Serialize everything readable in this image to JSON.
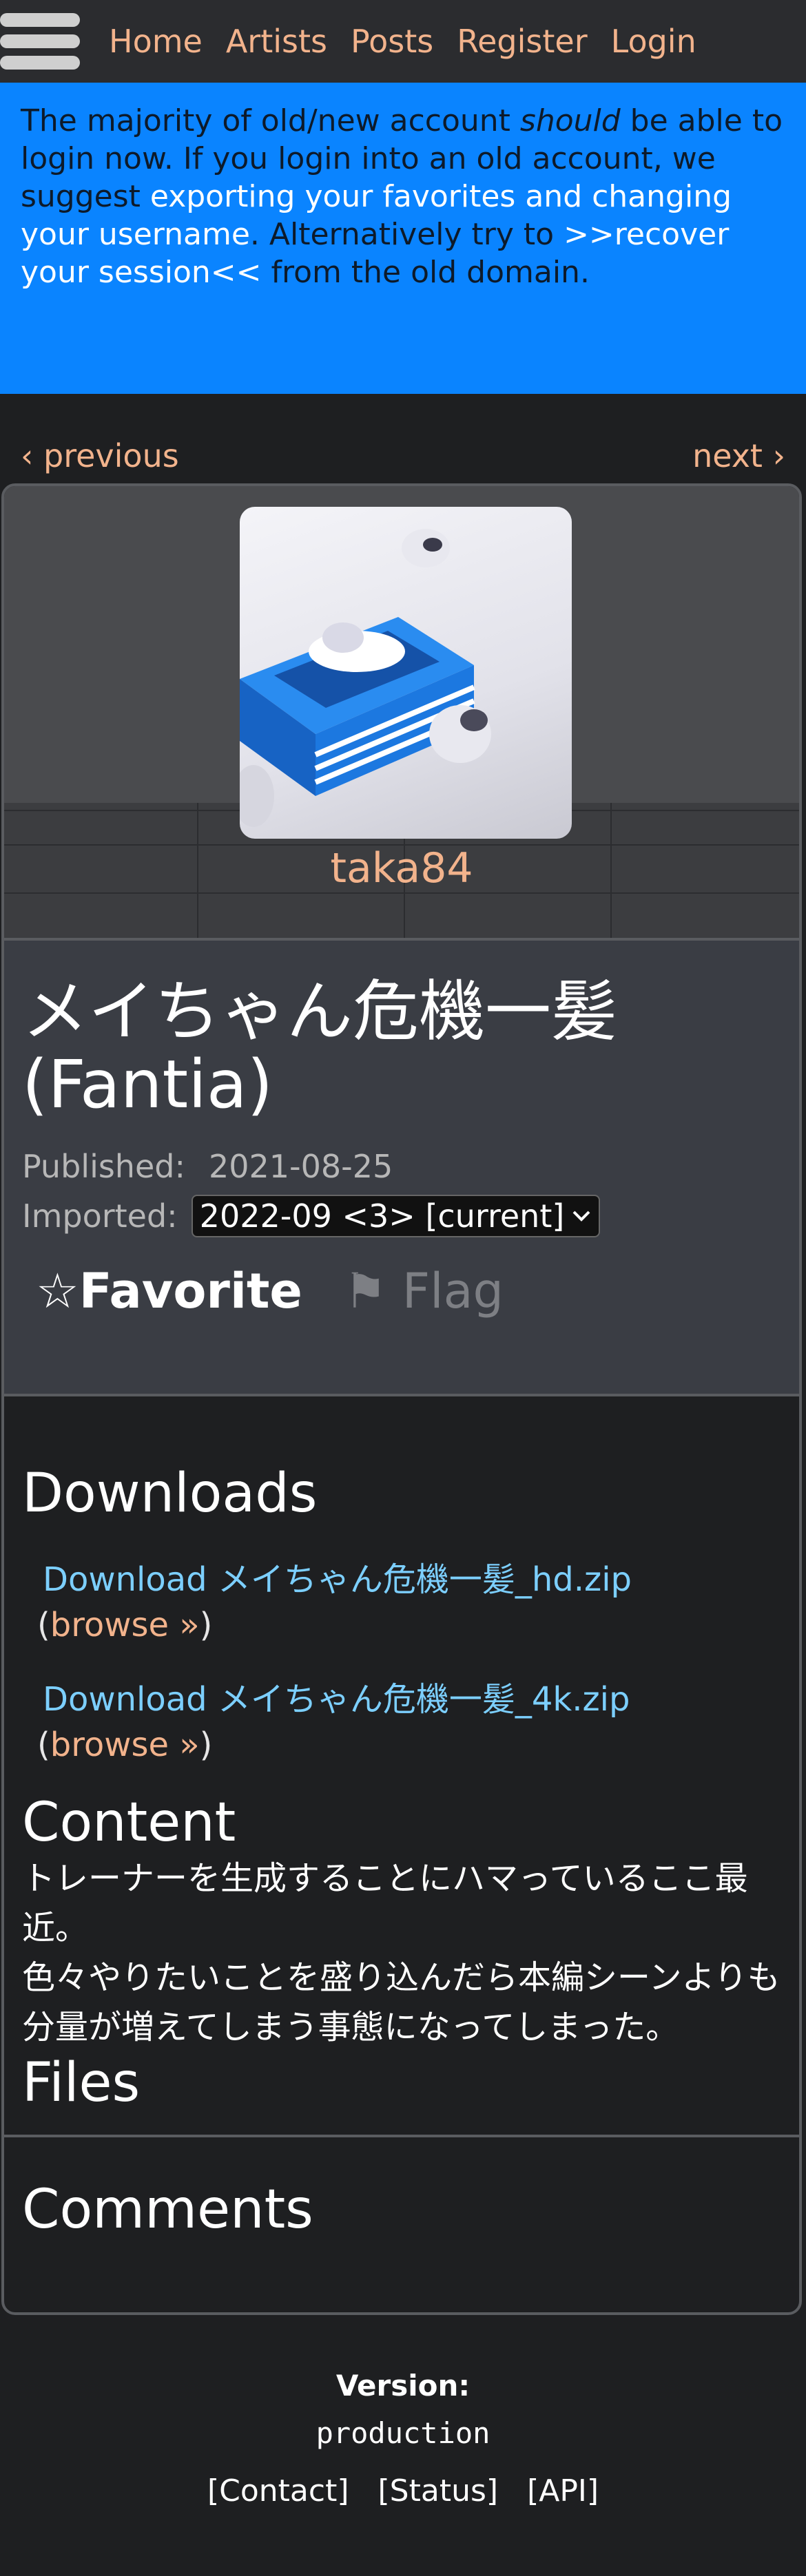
{
  "nav": {
    "items": [
      "Home",
      "Artists",
      "Posts",
      "Register",
      "Login"
    ]
  },
  "banner": {
    "part1": "The majority of old/new account ",
    "emphasis": "should",
    "part2": " be able to login now. If you login into an old account, we suggest ",
    "link1": "exporting your favorites and changing your username",
    "part3": ". Alternatively try to ",
    "link2": ">>recover your session<<",
    "part4": " from the old domain."
  },
  "pager": {
    "previous": "‹ previous",
    "next": "next ›"
  },
  "post": {
    "artist": "taka84",
    "title": "メイちゃん危機一髪(Fantia)",
    "published_label": "Published:",
    "published_value": "2021-08-25",
    "imported_label": "Imported:",
    "imported_value": "2022-09 <3> [current]",
    "favorite_label": "☆Favorite",
    "flag_label": "⚑ Flag"
  },
  "downloads": {
    "heading": "Downloads",
    "items": [
      {
        "label": "Download メイちゃん危機一髪_hd.zip",
        "browse": "browse »"
      },
      {
        "label": "Download メイちゃん危機一髪_4k.zip",
        "browse": "browse »"
      }
    ]
  },
  "content": {
    "heading": "Content",
    "line1": "トレーナーを生成することにハマっているここ最近。",
    "line2": "色々やりたいことを盛り込んだら本編シーンよりも分量が増えてしまう事態になってしまった。"
  },
  "files": {
    "heading": "Files"
  },
  "comments": {
    "heading": "Comments"
  },
  "footer": {
    "version_label": "Version:",
    "version_value": "production",
    "links": [
      "[Contact]",
      "[Status]",
      "[API]"
    ]
  }
}
